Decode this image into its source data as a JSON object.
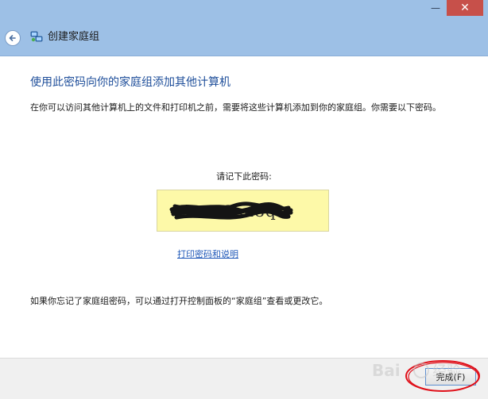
{
  "window": {
    "title": "创建家庭组",
    "controls": {
      "minimize_glyph": "—",
      "close_glyph": "✕"
    }
  },
  "content": {
    "heading": "使用此密码向你的家庭组添加其他计算机",
    "description": "在你可以访问其他计算机上的文件和打印机之前，需要将这些计算机添加到你的家庭组。你需要以下密码。",
    "password_label": "请记下此密码:",
    "password_value": "xxxxx2su8q",
    "print_link": "打印密码和说明",
    "footer_note": "如果你忘记了家庭组密码，可以通过打开控制面板的“家庭组”查看或更改它。"
  },
  "footer": {
    "finish_button": "完成(F)"
  },
  "colors": {
    "titlebar": "#9dc0e6",
    "heading": "#1e4e9a",
    "link": "#1f58b8",
    "password_bg": "#fdf9a8",
    "annotation_red": "#e0101a",
    "close_button": "#c7504a"
  },
  "icons": {
    "back": "back-arrow-icon",
    "header": "homegroup-network-icon"
  }
}
